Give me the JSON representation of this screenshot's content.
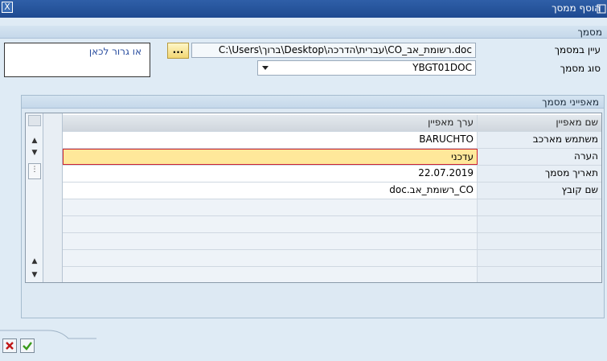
{
  "window": {
    "title": "הוסף ממסך",
    "close_glyph": "X"
  },
  "document_section": {
    "title": "מסמך",
    "browse_label": "עיין במסמך",
    "path_value": "C:\\Users\\ברוך\\Desktop\\עברית\\הדרכה\\CO_רשומת_אב.doc",
    "browse_button": "...",
    "doctype_label": "סוג מסמך",
    "doctype_value": "YBGT01DOC",
    "drop_text": "או גרור לכאן"
  },
  "properties_section": {
    "title": "מאפייני מסמך",
    "columns": {
      "name": "שם מאפיין",
      "value": "ערך מאפיין"
    },
    "rows": [
      {
        "name": "משתמש מארכב",
        "value": "BARUCHTO"
      },
      {
        "name": "הערה",
        "value": "עדכני"
      },
      {
        "name": "תאריך מסמך",
        "value": "22.07.2019"
      },
      {
        "name": "שם קובץ",
        "value": "CO_רשומת_אב.doc"
      }
    ]
  },
  "footer": {
    "cancel_icon": "cancel-icon",
    "confirm_icon": "confirm-icon"
  }
}
